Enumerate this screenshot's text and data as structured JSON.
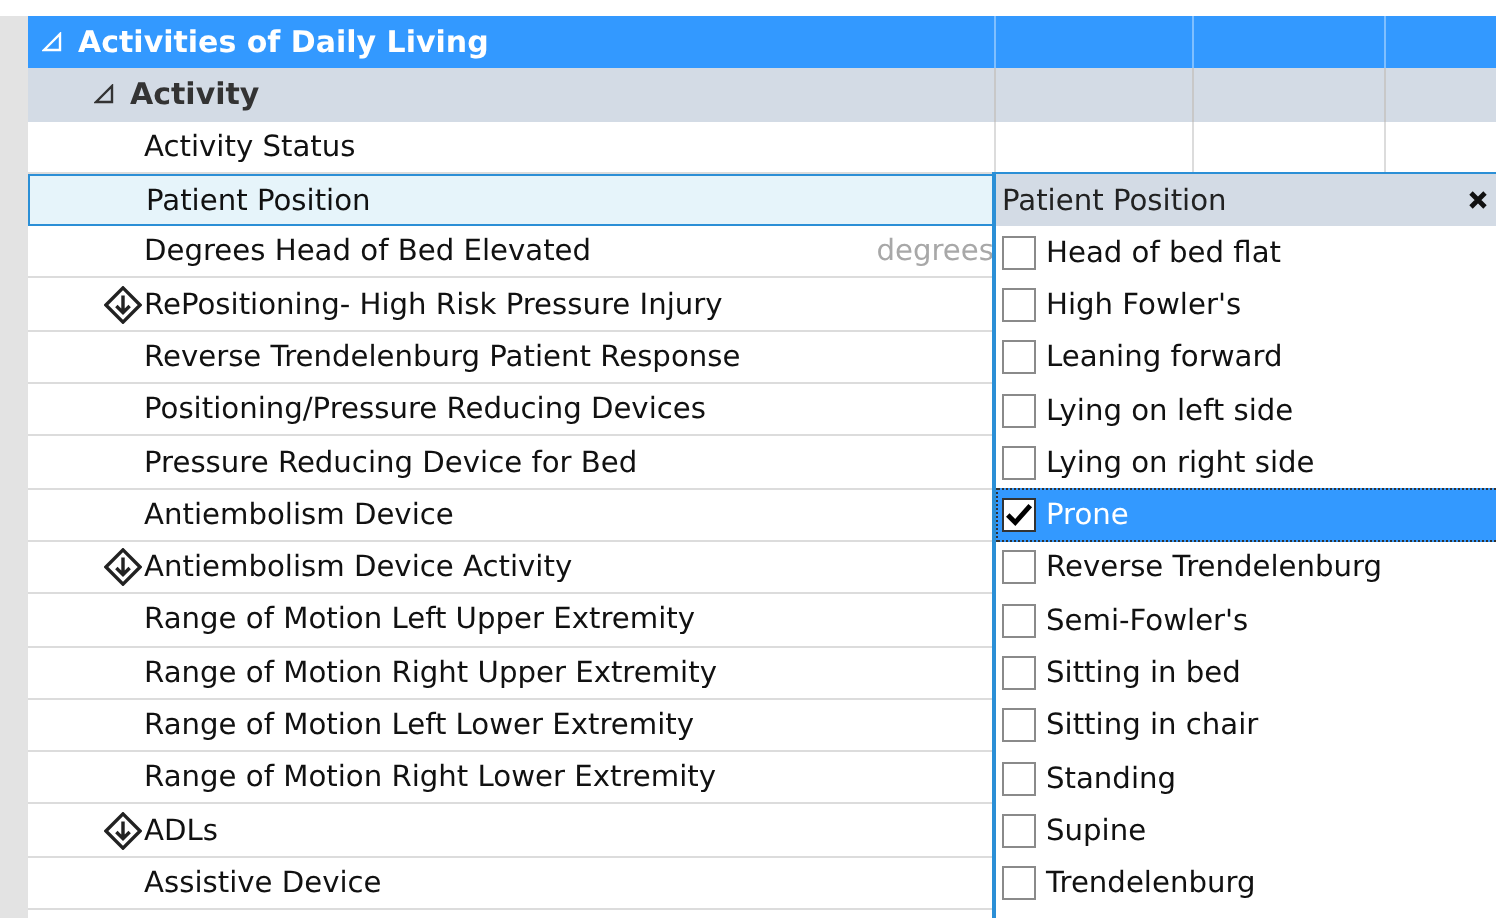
{
  "section": {
    "label": "Activities of Daily Living",
    "expanded": true
  },
  "group": {
    "label": "Activity",
    "expanded": true
  },
  "rows": [
    {
      "label": "Activity Status",
      "kind": "plain",
      "selected": false
    },
    {
      "label": "Patient Position",
      "kind": "plain",
      "selected": true
    },
    {
      "label": "Degrees Head of Bed Elevated",
      "kind": "plain",
      "selected": false,
      "unit": "degrees"
    },
    {
      "label": "RePositioning- High Risk Pressure Injury",
      "kind": "linked",
      "selected": false
    },
    {
      "label": "Reverse Trendelenburg Patient Response",
      "kind": "plain",
      "selected": false
    },
    {
      "label": "Positioning/Pressure Reducing Devices",
      "kind": "plain",
      "selected": false
    },
    {
      "label": "Pressure Reducing Device for Bed",
      "kind": "plain",
      "selected": false
    },
    {
      "label": "Antiembolism Device",
      "kind": "plain",
      "selected": false
    },
    {
      "label": "Antiembolism Device Activity",
      "kind": "linked",
      "selected": false
    },
    {
      "label": "Range of Motion Left Upper Extremity",
      "kind": "plain",
      "selected": false
    },
    {
      "label": "Range of Motion Right Upper Extremity",
      "kind": "plain",
      "selected": false
    },
    {
      "label": "Range of Motion Left Lower Extremity",
      "kind": "plain",
      "selected": false
    },
    {
      "label": "Range of Motion Right Lower Extremity",
      "kind": "plain",
      "selected": false
    },
    {
      "label": "ADLs",
      "kind": "linked",
      "selected": false
    },
    {
      "label": "Assistive Device",
      "kind": "plain",
      "selected": false
    }
  ],
  "popup": {
    "title": "Patient Position",
    "options": [
      {
        "label": "Head of bed flat",
        "checked": false,
        "selected": false
      },
      {
        "label": "High Fowler's",
        "checked": false,
        "selected": false
      },
      {
        "label": "Leaning forward",
        "checked": false,
        "selected": false
      },
      {
        "label": "Lying on left side",
        "checked": false,
        "selected": false
      },
      {
        "label": "Lying on right side",
        "checked": false,
        "selected": false
      },
      {
        "label": "Prone",
        "checked": true,
        "selected": true
      },
      {
        "label": "Reverse Trendelenburg",
        "checked": false,
        "selected": false
      },
      {
        "label": "Semi-Fowler's",
        "checked": false,
        "selected": false
      },
      {
        "label": "Sitting in bed",
        "checked": false,
        "selected": false
      },
      {
        "label": "Sitting in chair",
        "checked": false,
        "selected": false
      },
      {
        "label": "Standing",
        "checked": false,
        "selected": false
      },
      {
        "label": "Supine",
        "checked": false,
        "selected": false
      },
      {
        "label": "Trendelenburg",
        "checked": false,
        "selected": false
      }
    ]
  }
}
